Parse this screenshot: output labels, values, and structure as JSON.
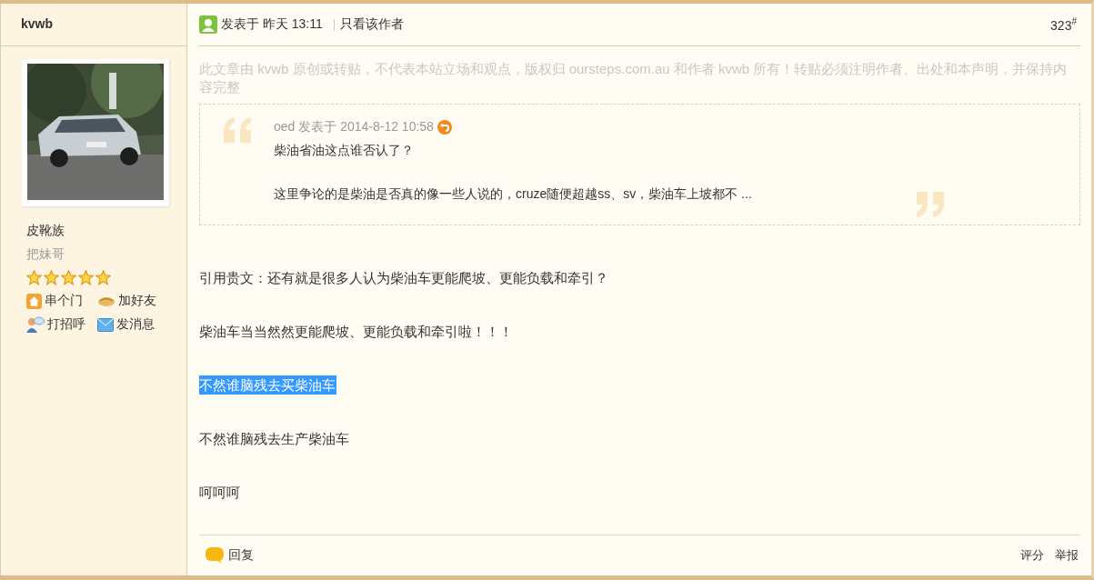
{
  "author": {
    "name": "kvwb",
    "title": "皮靴族",
    "rank": "把妹哥",
    "stars": 5,
    "actions": [
      {
        "kind": "home",
        "label": "串个门"
      },
      {
        "kind": "friend",
        "label": "加好友"
      },
      {
        "kind": "greet",
        "label": "打招呼"
      },
      {
        "kind": "message",
        "label": "发消息"
      }
    ]
  },
  "post": {
    "posted": "发表于 昨天 13:11",
    "author_only": "只看该作者",
    "floor": "323",
    "floor_mark": "#",
    "notice": "此文章由 kvwb 原创或转贴，不代表本站立场和观点，版权归 oursteps.com.au 和作者 kvwb 所有！转贴必须注明作者、出处和本声明，并保持内容完整",
    "quote": {
      "header": "oed 发表于 2014-8-12 10:58",
      "lines": [
        "柴油省油这点谁否认了？",
        "这里争论的是柴油是否真的像一些人说的，cruze随便超越ss、sv，柴油车上坡都不 ..."
      ]
    },
    "paragraphs": [
      {
        "text": "引用贵文：还有就是很多人认为柴油车更能爬坡、更能负载和牵引？",
        "selected": false
      },
      {
        "text": "柴油车当当然然更能爬坡、更能负载和牵引啦！！！",
        "selected": false
      },
      {
        "text": "不然谁脑残去买柴油车",
        "selected": true
      },
      {
        "text": "不然谁脑残去生产柴油车",
        "selected": false
      },
      {
        "text": "呵呵呵",
        "selected": false
      }
    ],
    "footer": {
      "reply": "回复",
      "links": [
        "评分",
        "举报"
      ]
    }
  }
}
